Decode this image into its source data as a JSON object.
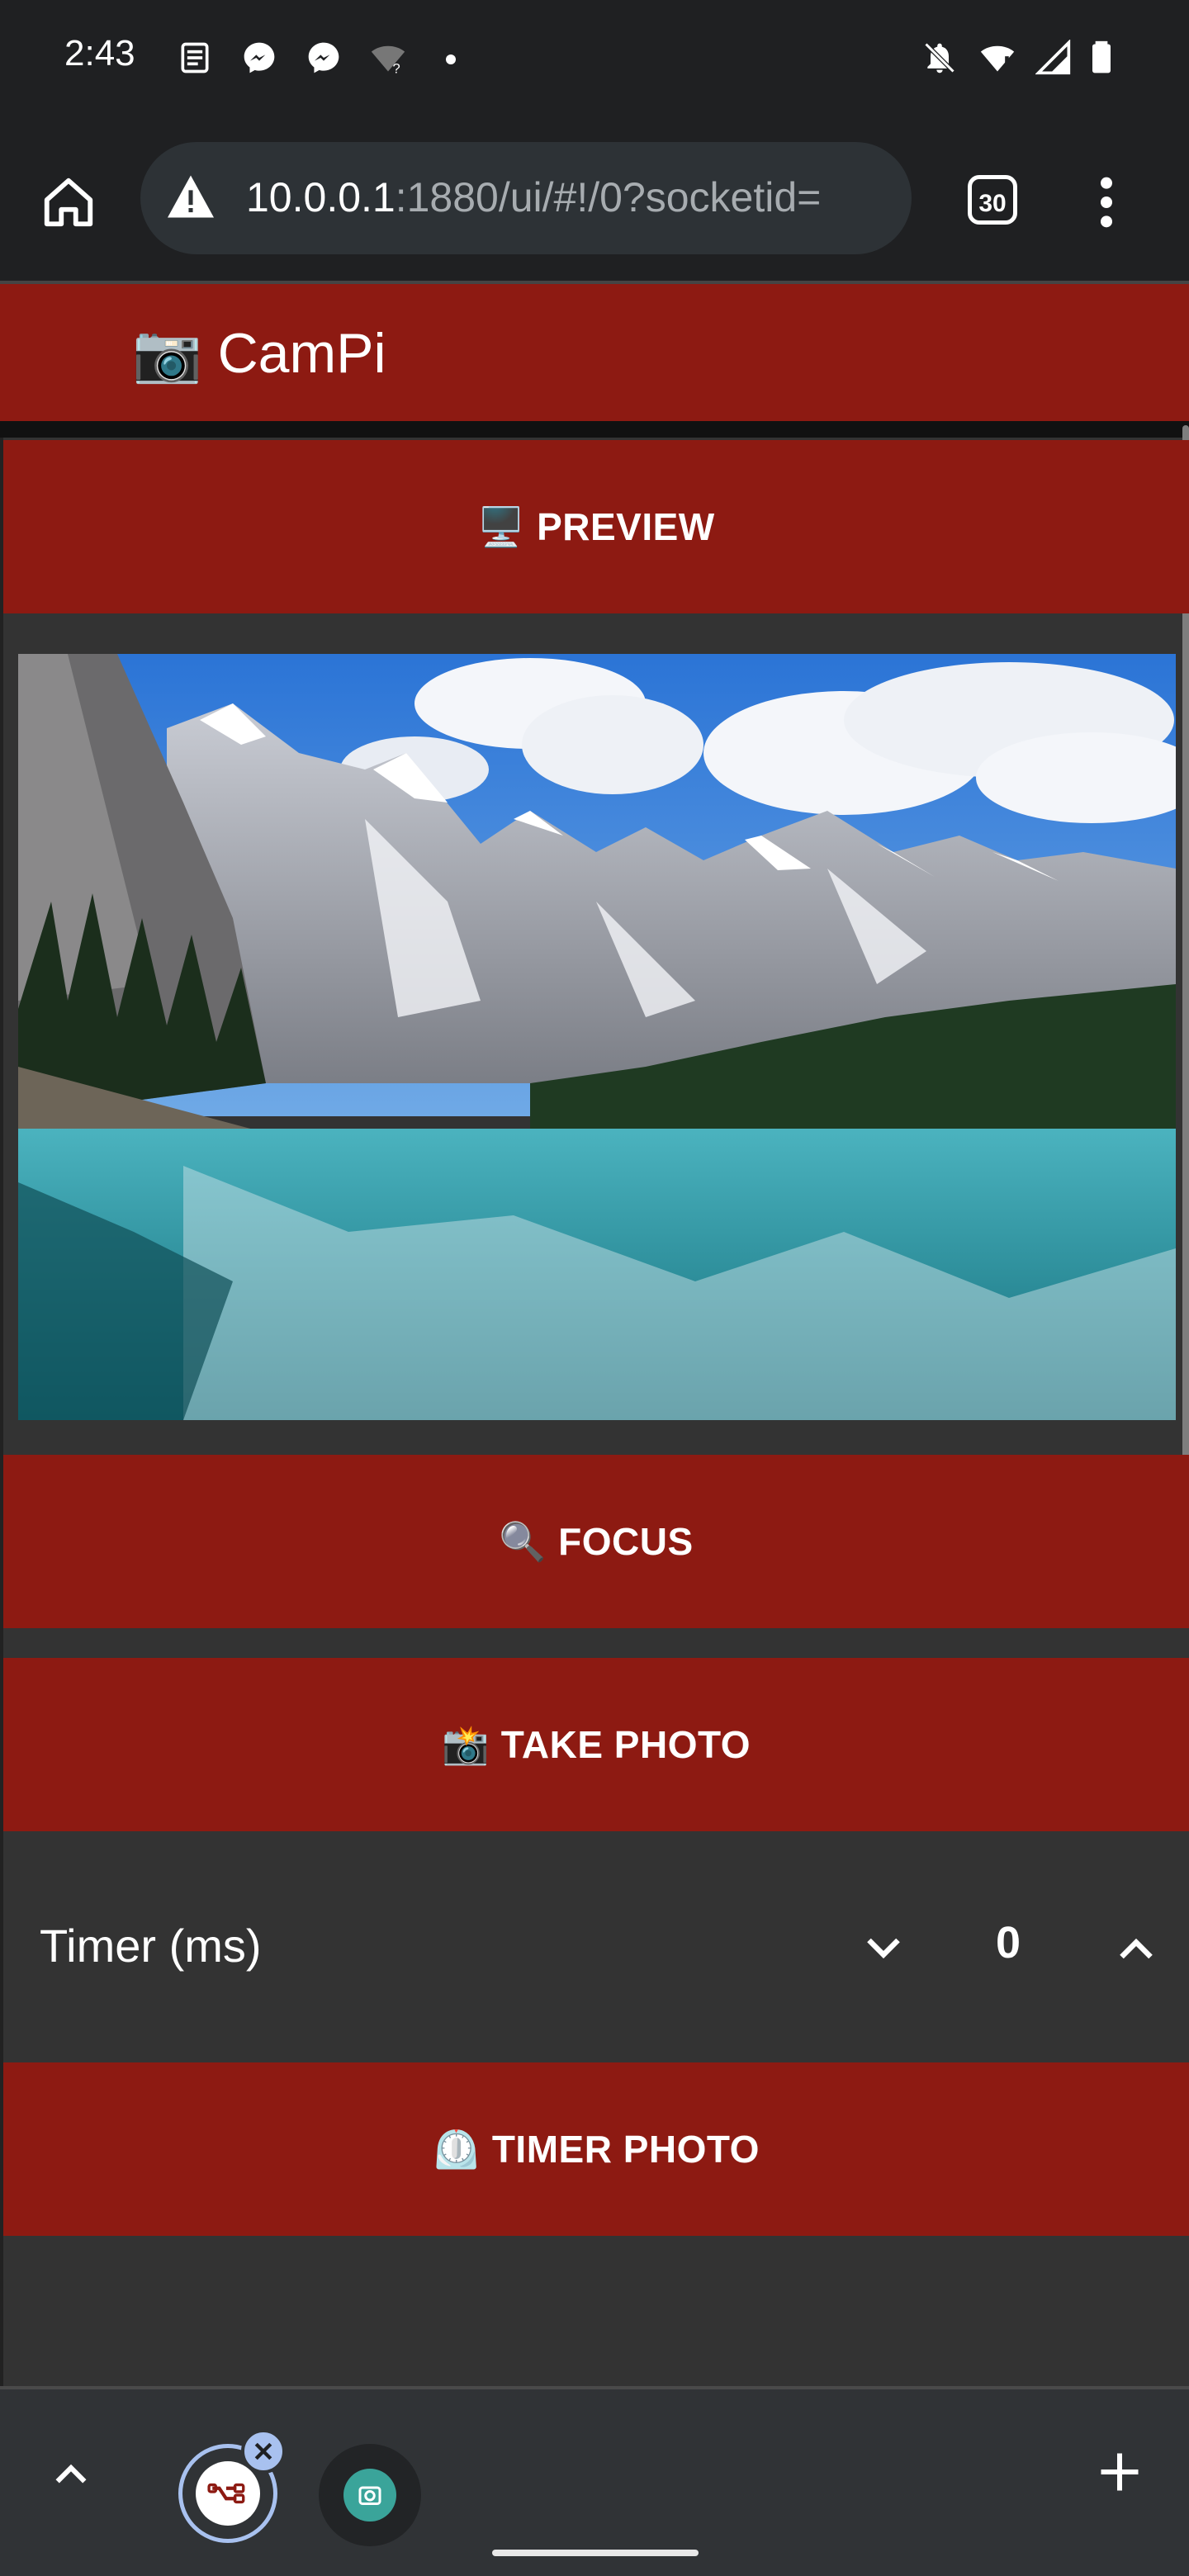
{
  "status_bar": {
    "time": "2:43",
    "icons": [
      "news-icon",
      "messenger-icon",
      "messenger-icon",
      "wifi-unknown-icon",
      "dot-icon",
      "bell-off-icon",
      "wifi-icon",
      "signal-icon",
      "battery-icon"
    ]
  },
  "browser": {
    "home_icon": "home-icon",
    "warning_icon": "warning-icon",
    "url_host": "10.0.0.1",
    "url_rest": ":1880/ui/#!/0?socketid=",
    "tab_count": "30",
    "menu_icon": "more-vert-icon"
  },
  "app": {
    "title_emoji": "📷",
    "title": "CamPi"
  },
  "buttons": {
    "preview_emoji": "🖥️",
    "preview": "PREVIEW",
    "focus_emoji": "🔍",
    "focus": "FOCUS",
    "take_photo_emoji": "📸",
    "take_photo": "TAKE PHOTO",
    "timer_photo_emoji": "⏲️",
    "timer_photo": "TIMER PHOTO"
  },
  "timer": {
    "label": "Timer (ms)",
    "value": "0"
  },
  "tab_strip": {
    "tabs": [
      "node-red-icon",
      "camera-icon"
    ]
  },
  "colors": {
    "accent": "#8d1a12",
    "panel": "#333333",
    "chrome": "#1f2022"
  }
}
